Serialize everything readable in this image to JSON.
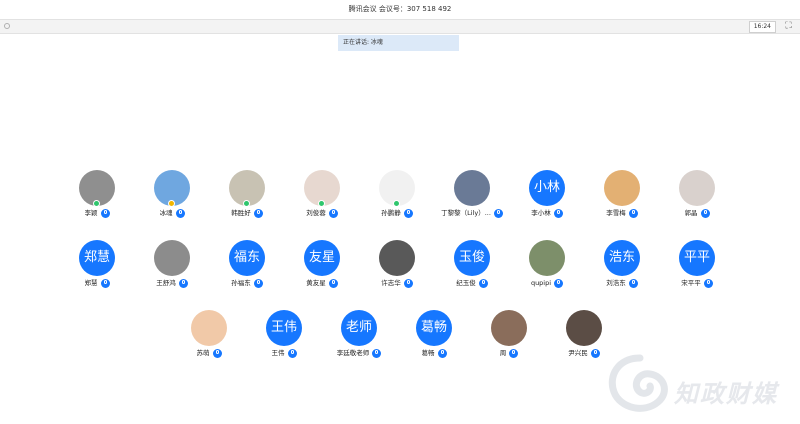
{
  "window": {
    "title": "腾讯会议  会议号：307 518 492"
  },
  "toolbar": {
    "time": "16:24"
  },
  "speaking": {
    "text": "正在讲话: 冰魂"
  },
  "rows": [
    [
      {
        "name": "李颖",
        "avatar": {
          "type": "photo",
          "color": "#8f8f8f"
        },
        "badge": "green"
      },
      {
        "name": "冰魂",
        "avatar": {
          "type": "photo",
          "color": "#6fa7e0"
        },
        "badge": "yellow"
      },
      {
        "name": "韩胜好",
        "avatar": {
          "type": "photo",
          "color": "#c8c2b3"
        },
        "badge": "green"
      },
      {
        "name": "刘俊蓉",
        "avatar": {
          "type": "photo",
          "color": "#e7d8d0"
        },
        "badge": "green"
      },
      {
        "name": "孙鹏静",
        "avatar": {
          "type": "photo",
          "color": "#f1f1f1"
        },
        "badge": "green"
      },
      {
        "name": "丁黎黎（Lily）...",
        "avatar": {
          "type": "photo",
          "color": "#6a7a96"
        }
      },
      {
        "name": "李小林",
        "avatar": {
          "type": "text",
          "text": "小林"
        }
      },
      {
        "name": "李雪梅",
        "avatar": {
          "type": "photo",
          "color": "#e3b073"
        }
      },
      {
        "name": "郭晶",
        "avatar": {
          "type": "photo",
          "color": "#d9d1cd"
        }
      }
    ],
    [
      {
        "name": "郑慧",
        "avatar": {
          "type": "text",
          "text": "郑慧"
        }
      },
      {
        "name": "王舒鸿",
        "avatar": {
          "type": "photo",
          "color": "#8c8c8c"
        }
      },
      {
        "name": "孙福东",
        "avatar": {
          "type": "text",
          "text": "福东"
        }
      },
      {
        "name": "黄友星",
        "avatar": {
          "type": "text",
          "text": "友星"
        }
      },
      {
        "name": "许志华",
        "avatar": {
          "type": "photo",
          "color": "#595959"
        }
      },
      {
        "name": "纪玉俊",
        "avatar": {
          "type": "text",
          "text": "玉俊"
        }
      },
      {
        "name": "qupipi",
        "avatar": {
          "type": "photo",
          "color": "#7d8f6a"
        }
      },
      {
        "name": "刘浩东",
        "avatar": {
          "type": "text",
          "text": "浩东"
        }
      },
      {
        "name": "宋平平",
        "avatar": {
          "type": "text",
          "text": "平平"
        }
      }
    ],
    [
      {
        "name": "苏萌",
        "avatar": {
          "type": "photo",
          "color": "#f1c9a8"
        }
      },
      {
        "name": "王伟",
        "avatar": {
          "type": "text",
          "text": "王伟"
        }
      },
      {
        "name": "李廷敬老师",
        "avatar": {
          "type": "text",
          "text": "老师"
        }
      },
      {
        "name": "葛畅",
        "avatar": {
          "type": "text",
          "text": "葛畅"
        }
      },
      {
        "name": "周",
        "avatar": {
          "type": "photo",
          "color": "#8a6d5b"
        }
      },
      {
        "name": "尹兴民",
        "avatar": {
          "type": "photo",
          "color": "#5b4d45"
        }
      }
    ]
  ],
  "watermark": {
    "text": "知政财媒"
  }
}
